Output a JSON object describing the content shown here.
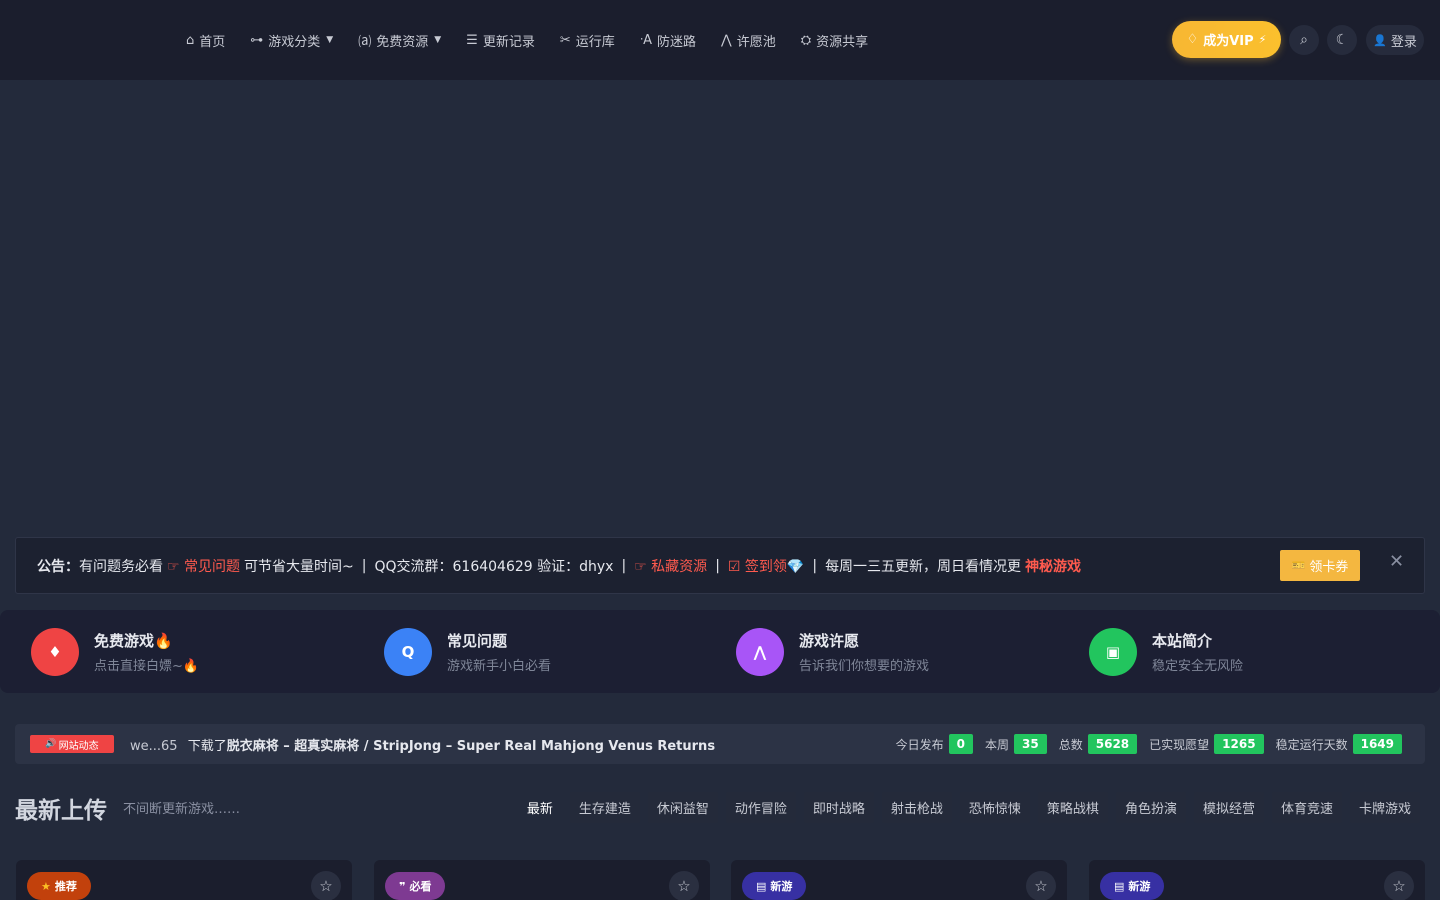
{
  "nav": {
    "items": [
      {
        "icon": "home-icon",
        "glyph": "⌂",
        "label": "首页"
      },
      {
        "icon": "gamepad-icon",
        "glyph": "⊶",
        "label": "游戏分类",
        "dropdown": true
      },
      {
        "icon": "resource-icon",
        "glyph": "⒜",
        "label": "免费资源",
        "dropdown": true
      },
      {
        "icon": "list-icon",
        "glyph": "☰",
        "label": "更新记录"
      },
      {
        "icon": "tools-icon",
        "glyph": "✂",
        "label": "运行库"
      },
      {
        "icon": "signal-icon",
        "glyph": "ᐧA",
        "label": "防迷路"
      },
      {
        "icon": "pray-icon",
        "glyph": "⋀",
        "label": "许愿池"
      },
      {
        "icon": "share-icon",
        "glyph": "⛭",
        "label": "资源共享"
      }
    ]
  },
  "header": {
    "vip_label": "成为VIP",
    "vip_icon": "♢",
    "vip_spark": "⚡",
    "search_icon": "⌕",
    "theme_icon": "☾",
    "login_label": "登录",
    "login_icon": "👤"
  },
  "notice": {
    "label": "公告：",
    "part1": "有问题务必看",
    "link1": "☞ 常见问题",
    "part2": "可节省大量时间~",
    "part3": "QQ交流群：616404629 验证：dhyx",
    "link2": "☞ 私藏资源",
    "link3": "☑ 签到领💎",
    "part4": "每周一三五更新，周日看情况更",
    "link4": "神秘游戏",
    "sep": "|",
    "coupon_label": "领卡券",
    "coupon_icon": "🎫",
    "close": "✕"
  },
  "features": [
    {
      "title": "免费游戏🔥",
      "sub": "点击直接白嫖~🔥",
      "icon": "fire-icon",
      "glyph": "♦",
      "color": "#ef4444"
    },
    {
      "title": "常见问题",
      "sub": "游戏新手小白必看",
      "icon": "question-icon",
      "glyph": "Q",
      "color": "#3b82f6"
    },
    {
      "title": "游戏许愿",
      "sub": "告诉我们你想要的游戏",
      "icon": "pray-icon",
      "glyph": "⋀",
      "color": "#a855f7"
    },
    {
      "title": "本站简介",
      "sub": "稳定安全无风险",
      "icon": "info-icon",
      "glyph": "▣",
      "color": "#22c55e"
    }
  ],
  "activity": {
    "badge": "网站动态",
    "badge_icon": "🔊",
    "user": "we...65",
    "action": "下载了",
    "game": "脱衣麻将 – 超真实麻将 / StripJong – Super Real Mahjong Venus Returns",
    "stats": [
      {
        "label": "今日发布",
        "value": "0"
      },
      {
        "label": "本周",
        "value": "35"
      },
      {
        "label": "总数",
        "value": "5628"
      },
      {
        "label": "已实现愿望",
        "value": "1265"
      },
      {
        "label": "稳定运行天数",
        "value": "1649"
      }
    ]
  },
  "section": {
    "title": "最新上传",
    "subtitle": "不间断更新游戏……",
    "categories": [
      "最新",
      "生存建造",
      "休闲益智",
      "动作冒险",
      "即时战略",
      "射击枪战",
      "恐怖惊悚",
      "策略战棋",
      "角色扮演",
      "模拟经营",
      "体育竞速",
      "卡牌游戏"
    ],
    "active": 0
  },
  "cards": [
    {
      "tag": "推荐",
      "tag_icon": "★",
      "tag_color": "#c2410c",
      "star": "☆"
    },
    {
      "tag": "必看",
      "tag_icon": "❞",
      "tag_color": "#7e3a92",
      "star": "☆"
    },
    {
      "tag": "新游",
      "tag_icon": "▤",
      "tag_color": "#3730a3",
      "star": "☆"
    },
    {
      "tag": "新游",
      "tag_icon": "▤",
      "tag_color": "#3730a3",
      "star": "☆"
    }
  ]
}
